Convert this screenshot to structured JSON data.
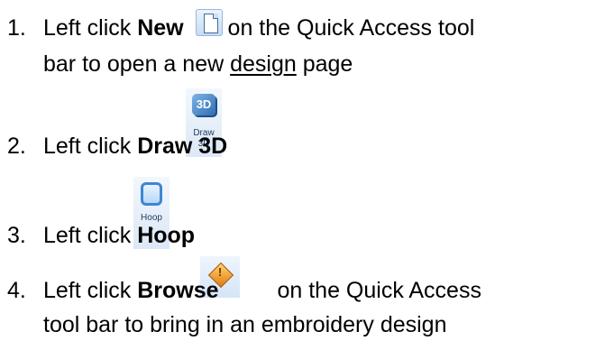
{
  "steps": [
    {
      "number": "1.",
      "prefix": "Left click ",
      "bold": "New",
      "suffix": " on the Quick Access tool",
      "line2_a": "bar to open a new ",
      "line2_u": "design",
      "line2_b": " page",
      "icon": "new-document-icon"
    },
    {
      "number": "2.",
      "prefix": "Left click ",
      "bold": "Draw 3D",
      "icon": "draw-3d-icon",
      "icon_caption_1": "Draw",
      "icon_caption_2": "3D",
      "icon_badge": "3D"
    },
    {
      "number": "3.",
      "prefix": "Left click ",
      "bold": "Hoop",
      "icon": "hoop-icon",
      "icon_caption": "Hoop",
      "icon_arrow": "▾"
    },
    {
      "number": "4.",
      "prefix": "Left click ",
      "bold": "Browse",
      "suffix": " on the Quick Access",
      "line2": "tool bar to bring in an embroidery design",
      "icon": "browse-icon",
      "icon_mark": "!"
    }
  ]
}
